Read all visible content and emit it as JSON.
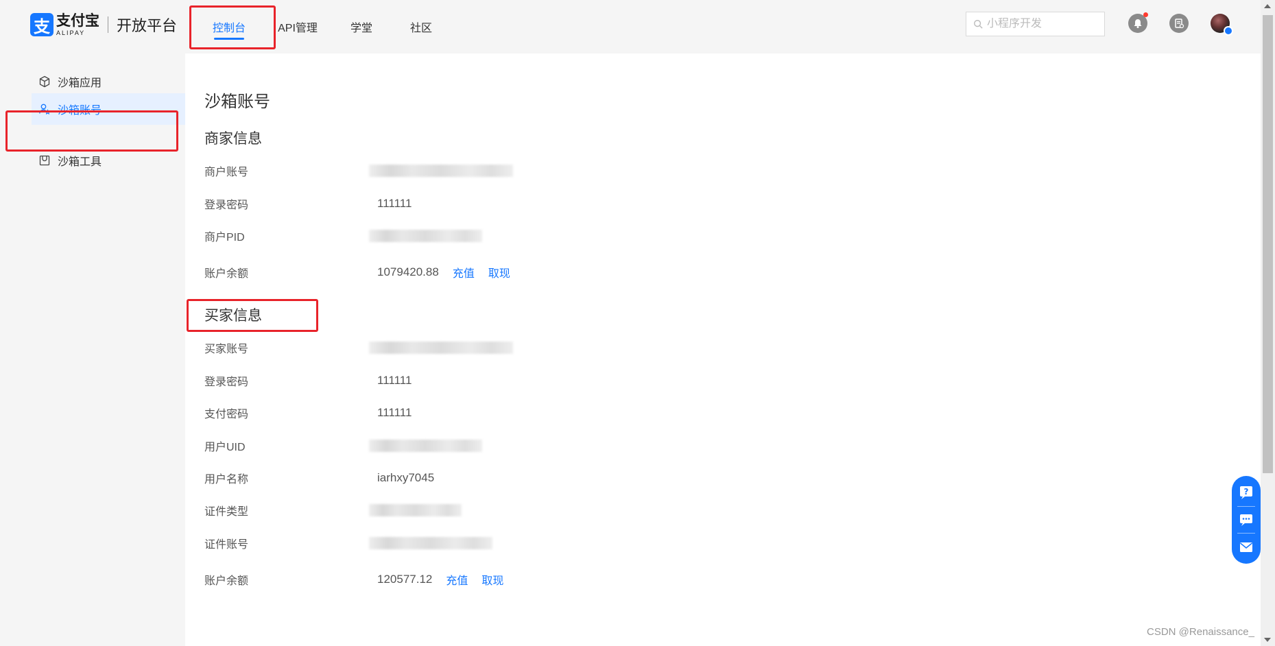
{
  "header": {
    "logo_cn": "支付宝",
    "logo_en": "ALIPAY",
    "logo_mark": "支",
    "platform": "开放平台",
    "nav": [
      {
        "label": "控制台",
        "active": true
      },
      {
        "label": "API管理",
        "active": false
      },
      {
        "label": "学堂",
        "active": false
      },
      {
        "label": "社区",
        "active": false
      }
    ],
    "search_placeholder": "小程序开发"
  },
  "sidebar": {
    "items": [
      {
        "label": "沙箱应用",
        "icon": "cube-icon",
        "active": false
      },
      {
        "label": "沙箱账号",
        "icon": "user-star-icon",
        "active": true
      },
      {
        "label": "沙箱工具",
        "icon": "bag-icon",
        "active": false
      }
    ]
  },
  "main": {
    "page_title": "沙箱账号",
    "merchant": {
      "title": "商家信息",
      "fields": [
        {
          "label": "商户账号",
          "value": ""
        },
        {
          "label": "登录密码",
          "value": "111111"
        },
        {
          "label": "商户PID",
          "value": ""
        },
        {
          "label": "账户余额",
          "value": "1079420.88"
        }
      ],
      "recharge_label": "充值",
      "withdraw_label": "取现"
    },
    "buyer": {
      "title": "买家信息",
      "fields": [
        {
          "label": "买家账号",
          "value": ""
        },
        {
          "label": "登录密码",
          "value": "111111"
        },
        {
          "label": "支付密码",
          "value": "111111"
        },
        {
          "label": "用户UID",
          "value": ""
        },
        {
          "label": "用户名称",
          "value": "iarhxy7045"
        },
        {
          "label": "证件类型",
          "value": ""
        },
        {
          "label": "证件账号",
          "value": ""
        },
        {
          "label": "账户余额",
          "value": "120577.12"
        }
      ],
      "recharge_label": "充值",
      "withdraw_label": "取现"
    }
  },
  "watermark": "CSDN @Renaissance_",
  "colors": {
    "accent": "#1677ff",
    "highlight": "#e8232a"
  }
}
